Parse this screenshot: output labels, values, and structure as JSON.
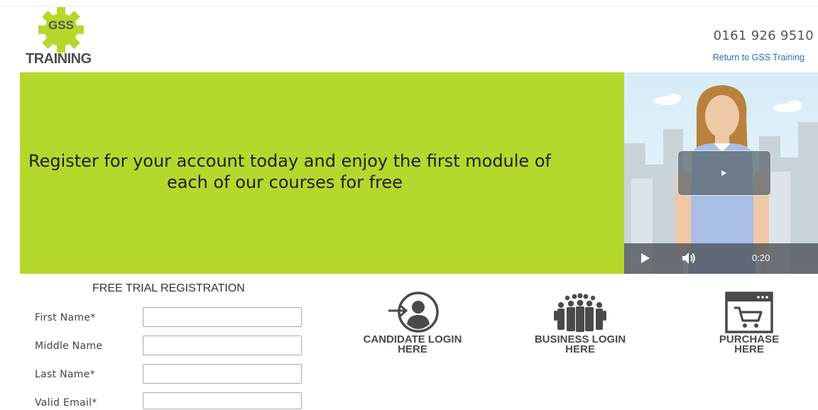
{
  "header": {
    "logo_gear_text": "GSS",
    "logo_brand_text": "TRAINING",
    "phone": "0161 926 9510",
    "return_link": "Return to GSS Training"
  },
  "hero": {
    "line1": "Register for your account today and enjoy the first module of",
    "line2": "each of our courses for free"
  },
  "video": {
    "time": "0:20",
    "icons": [
      "play-icon",
      "volume-icon"
    ]
  },
  "form": {
    "title": "FREE TRIAL REGISTRATION",
    "fields": [
      {
        "label": "First Name*",
        "value": ""
      },
      {
        "label": "Middle Name",
        "value": ""
      },
      {
        "label": "Last Name*",
        "value": ""
      },
      {
        "label": "Valid Email*",
        "value": ""
      }
    ]
  },
  "tiles": [
    {
      "line1": "CANDIDATE LOGIN",
      "line2": "HERE",
      "icon": "candidate-login-icon"
    },
    {
      "line1": "BUSINESS LOGIN",
      "line2": "HERE",
      "icon": "business-group-icon"
    },
    {
      "line1": "PURCHASE",
      "line2": "HERE",
      "icon": "shopping-cart-icon"
    }
  ],
  "colors": {
    "hero_green": "#b4d82c",
    "link_blue": "#2a6eb8",
    "text_dark": "#1f1f1f",
    "icon_gray": "#4a4a4a"
  }
}
